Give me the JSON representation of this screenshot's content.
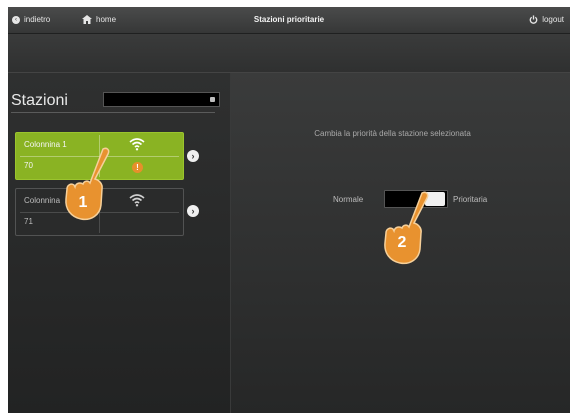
{
  "header": {
    "back_label": "indietro",
    "home_label": "home",
    "title": "Stazioni prioritarie",
    "logout_label": "logout"
  },
  "stations": {
    "title": "Stazioni",
    "items": [
      {
        "name": "Colonnina 1",
        "code": "70",
        "active": true,
        "alert_glyph": "!"
      },
      {
        "name": "Colonnina",
        "code": "71",
        "active": false
      }
    ]
  },
  "priority": {
    "description": "Cambia la priorità della stazione selezionata",
    "left_label": "Normale",
    "right_label": "Prioritaria",
    "state": "Prioritaria"
  },
  "annotations": [
    {
      "label": "1"
    },
    {
      "label": "2"
    }
  ],
  "colors": {
    "accent_green": "#8ab323",
    "alert_orange": "#e6902b",
    "hand_orange": "#e8922f"
  },
  "icons": {
    "back": "chevron-left-circle-icon",
    "home": "home-icon",
    "logout": "power-icon",
    "signal": "wifi-icon",
    "alert": "alert-icon",
    "next": "chevron-right-icon",
    "pointer": "hand-pointer-icon"
  }
}
